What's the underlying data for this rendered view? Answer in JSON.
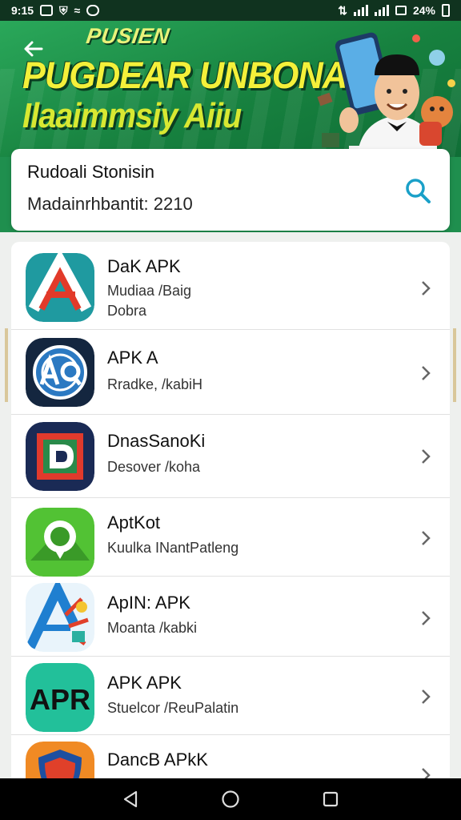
{
  "status_bar": {
    "time": "9:15",
    "battery": "24%"
  },
  "banner": {
    "kicker": "PUSIEN",
    "title": "PUGDEAR UNBONAIN",
    "subtitle": "Ilaaimmsiy Aiiu"
  },
  "search": {
    "title": "Rudoali Stonisin",
    "subtitle": "Madainrhbantit: 2210"
  },
  "apps": [
    {
      "name": "DaK APK",
      "line1": "Mudiaa /Baig",
      "line2": "Dobra",
      "icon": "letter-a-icon"
    },
    {
      "name": "APK A",
      "line1": "Rradke, /kabiH",
      "line2": "",
      "icon": "aq-globe-icon"
    },
    {
      "name": "DnasSanoKi",
      "line1": "Desover /koha",
      "line2": "",
      "icon": "frame-d-icon"
    },
    {
      "name": "AptKot",
      "line1": "Kuulka INantPatleng",
      "line2": "",
      "icon": "speech-bubble-icon"
    },
    {
      "name": "ApIN: APK",
      "line1": "Moanta /kabki",
      "line2": "",
      "icon": "colorful-a-icon"
    },
    {
      "name": "APK APK",
      "line1": "Stuelcor /ReuPalatin",
      "line2": "",
      "icon": "apr-text-icon"
    },
    {
      "name": "DancB APkK",
      "line1": "",
      "line2": "",
      "icon": "shield-icon"
    }
  ],
  "icon_text": {
    "apr": "APR"
  },
  "colors": {
    "brand_green": "#1f8f4e",
    "title_yellow": "#f4f03a",
    "search_blue": "#1aa0c8"
  }
}
